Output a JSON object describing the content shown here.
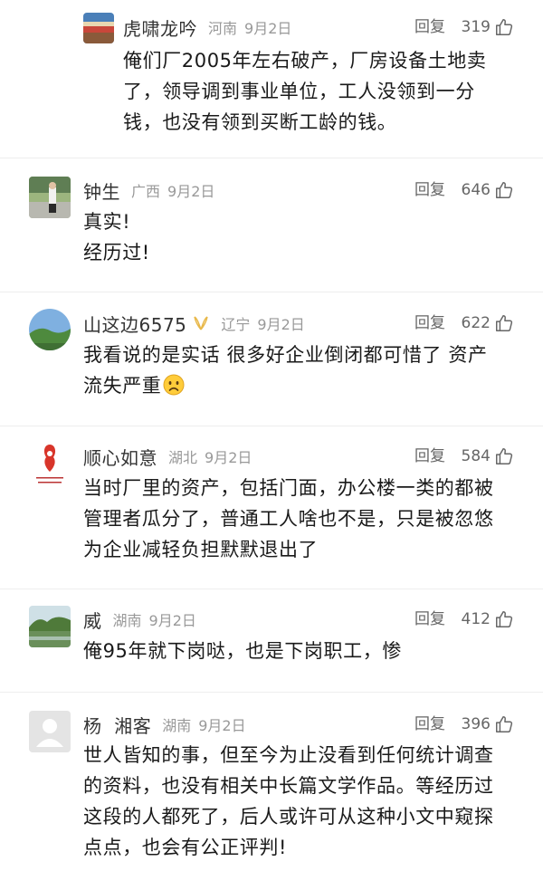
{
  "comments": [
    {
      "name": "虎啸龙吟",
      "location": "河南",
      "date": "9月2日",
      "reply_label": "回复",
      "likes": "319",
      "lines": [
        "俺们厂2005年左右破产，厂房设备土地卖",
        "了，领导调到事业单位，工人没领到一分",
        "钱，也没有领到买断工龄的钱。"
      ]
    },
    {
      "name": "钟生",
      "location": "广西",
      "date": "9月2日",
      "reply_label": "回复",
      "likes": "646",
      "lines": [
        "真实!",
        "经历过!"
      ]
    },
    {
      "name": "山这边6575",
      "location": "辽宁",
      "date": "9月2日",
      "reply_label": "回复",
      "likes": "622",
      "lines": [
        "我看说的是实话  很多好企业倒闭都可惜了  资产",
        "流失严重"
      ]
    },
    {
      "name": "顺心如意",
      "location": "湖北",
      "date": "9月2日",
      "reply_label": "回复",
      "likes": "584",
      "lines": [
        "当时厂里的资产，包括门面，办公楼一类的都被",
        "管理者瓜分了，普通工人啥也不是，只是被忽悠",
        "为企业减轻负担默默退出了"
      ]
    },
    {
      "name": "威",
      "location": "湖南",
      "date": "9月2日",
      "reply_label": "回复",
      "likes": "412",
      "lines": [
        "俺95年就下岗哒，也是下岗职工，惨"
      ]
    },
    {
      "name": "杨  湘客",
      "location": "湖南",
      "date": "9月2日",
      "reply_label": "回复",
      "likes": "396",
      "lines": [
        "世人皆知的事，但至今为止没看到任何统计调查",
        "的资料，也没有相关中长篇文学作品。等经历过",
        "这段的人都死了，后人或许可从这种小文中窥探",
        "点点，也会有公正评判!"
      ]
    }
  ],
  "colors": {
    "name": "#333333",
    "meta": "#999999",
    "text": "#1a1a1a",
    "divider": "#eeeeee"
  },
  "icons": {
    "like": "thumbs-up-icon",
    "vip": "vip-badge-icon",
    "emoji": "sad-face-emoji"
  }
}
